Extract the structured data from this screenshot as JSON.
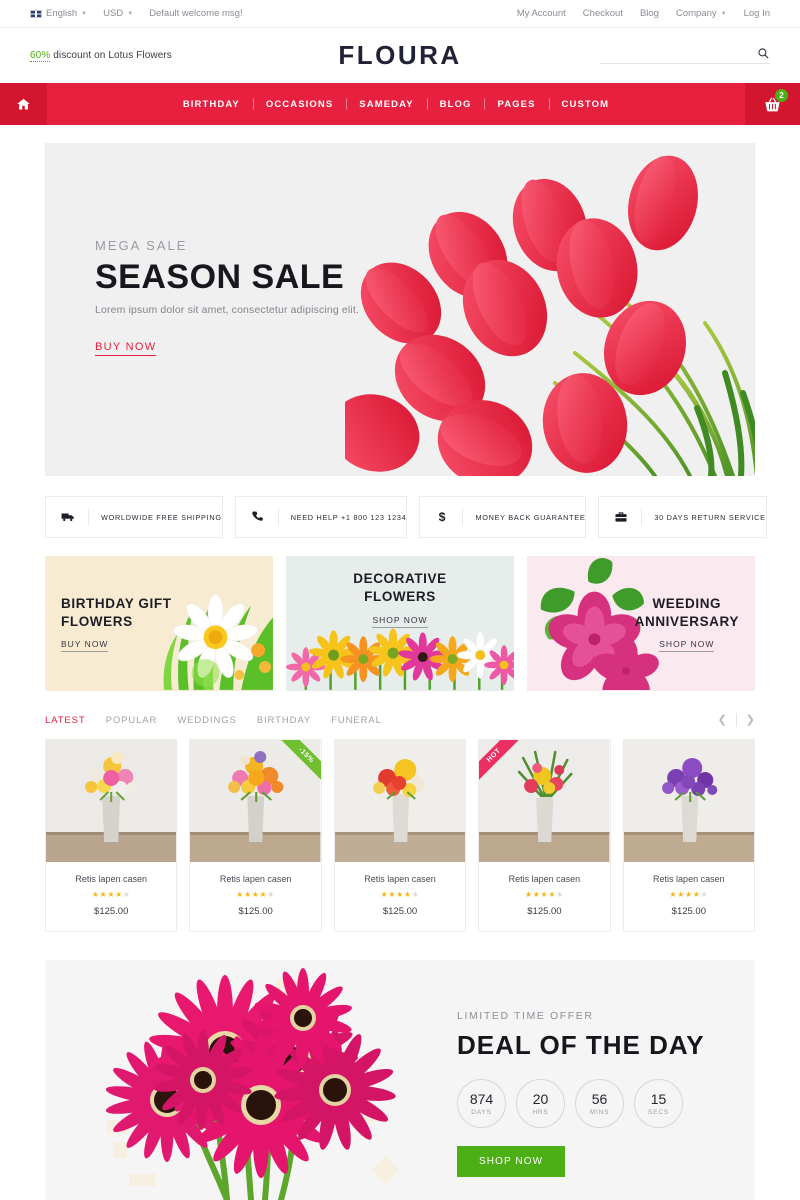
{
  "topbar": {
    "language": "English",
    "currency": "USD",
    "welcome": "Default welcome msg!",
    "links": [
      "My Account",
      "Checkout",
      "Blog",
      "Company",
      "Log In"
    ]
  },
  "header": {
    "promo_percent": "60%",
    "promo_text": "discount on Lotus Flowers",
    "logo": "FLOURA",
    "search_placeholder": "",
    "search_value": ""
  },
  "nav": {
    "home_icon": "home-icon",
    "items": [
      "BIRTHDAY",
      "OCCASIONS",
      "SAMEDAY",
      "BLOG",
      "PAGES",
      "CUSTOM"
    ],
    "cart_icon": "shopping-basket-icon",
    "cart_count": "2"
  },
  "hero": {
    "kicker": "MEGA SALE",
    "title": "SEASON SALE",
    "subtitle": "Lorem ipsum dolor sit amet, consectetur adipiscing elit.",
    "cta": "BUY NOW"
  },
  "features": [
    {
      "icon": "truck-icon",
      "label": "WORLDWIDE FREE SHIPPING"
    },
    {
      "icon": "phone-icon",
      "label": "NEED HELP +1 800 123 1234"
    },
    {
      "icon": "dollar-icon",
      "label": "MONEY BACK GUARANTEE"
    },
    {
      "icon": "briefcase-icon",
      "label": "30 DAYS RETURN SERVICE"
    }
  ],
  "promos": [
    {
      "title": "BIRTHDAY GIFT\nFLOWERS",
      "link": "BUY NOW"
    },
    {
      "title": "DECORATIVE\nFLOWERS",
      "link": "SHOP NOW"
    },
    {
      "title": "WEEDING\nANNIVERSARY",
      "link": "SHOP NOW"
    }
  ],
  "product_tabs": {
    "items": [
      "LATEST",
      "POPULAR",
      "WEDDINGS",
      "BIRTHDAY",
      "FUNERAL"
    ],
    "active": "LATEST",
    "prev_icon": "chevron-left-icon",
    "next_icon": "chevron-right-icon"
  },
  "products": [
    {
      "name": "Retis lapen casen",
      "rating": 4,
      "price": "$125.00",
      "badge": ""
    },
    {
      "name": "Retis lapen casen",
      "rating": 4,
      "price": "$125.00",
      "badge": "-15%"
    },
    {
      "name": "Retis lapen casen",
      "rating": 4,
      "price": "$125.00",
      "badge": ""
    },
    {
      "name": "Retis lapen casen",
      "rating": 4,
      "price": "$125.00",
      "badge": "HOT"
    },
    {
      "name": "Retis lapen casen",
      "rating": 4,
      "price": "$125.00",
      "badge": ""
    }
  ],
  "deal": {
    "kicker": "LIMITED TIME OFFER",
    "title": "DEAL OF THE DAY",
    "countdown": [
      {
        "value": "874",
        "unit": "DAYS"
      },
      {
        "value": "20",
        "unit": "HRS"
      },
      {
        "value": "56",
        "unit": "MINS"
      },
      {
        "value": "15",
        "unit": "SECS"
      }
    ],
    "button": "SHOP NOW"
  },
  "colors": {
    "brand_red": "#e8203f",
    "brand_red_dark": "#d3162f",
    "accent_green": "#4caf16",
    "star_gold": "#f5b716",
    "hot_pink": "#eb2f63",
    "tab_active": "#e0214a"
  }
}
